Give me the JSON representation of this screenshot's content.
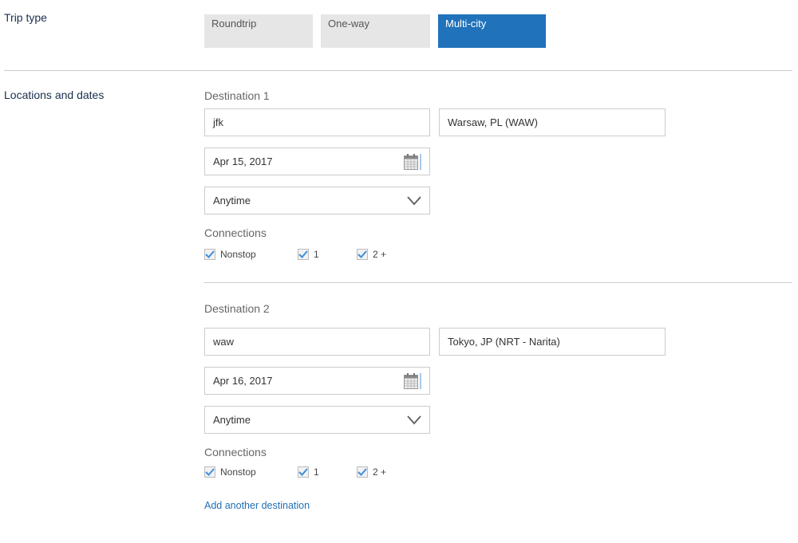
{
  "trip_type": {
    "label": "Trip type",
    "options": [
      {
        "label": "Roundtrip",
        "selected": false
      },
      {
        "label": "One-way",
        "selected": false
      },
      {
        "label": "Multi-city",
        "selected": true
      }
    ]
  },
  "locations": {
    "label": "Locations and dates",
    "destinations": [
      {
        "title": "Destination 1",
        "from": "jfk",
        "to": "Warsaw, PL (WAW)",
        "date": "Apr 15, 2017",
        "time": "Anytime",
        "connections_label": "Connections",
        "connections": [
          {
            "label": "Nonstop",
            "checked": true
          },
          {
            "label": "1",
            "checked": true
          },
          {
            "label": "2 +",
            "checked": true
          }
        ]
      },
      {
        "title": "Destination 2",
        "from": "waw",
        "to": "Tokyo, JP (NRT - Narita)",
        "date": "Apr 16, 2017",
        "time": "Anytime",
        "connections_label": "Connections",
        "connections": [
          {
            "label": "Nonstop",
            "checked": true
          },
          {
            "label": "1",
            "checked": true
          },
          {
            "label": "2 +",
            "checked": true
          }
        ]
      }
    ],
    "add_link": "Add another destination"
  },
  "colors": {
    "accent": "#2072bb",
    "link": "#1f6fb5",
    "check": "#3d8fdc"
  }
}
